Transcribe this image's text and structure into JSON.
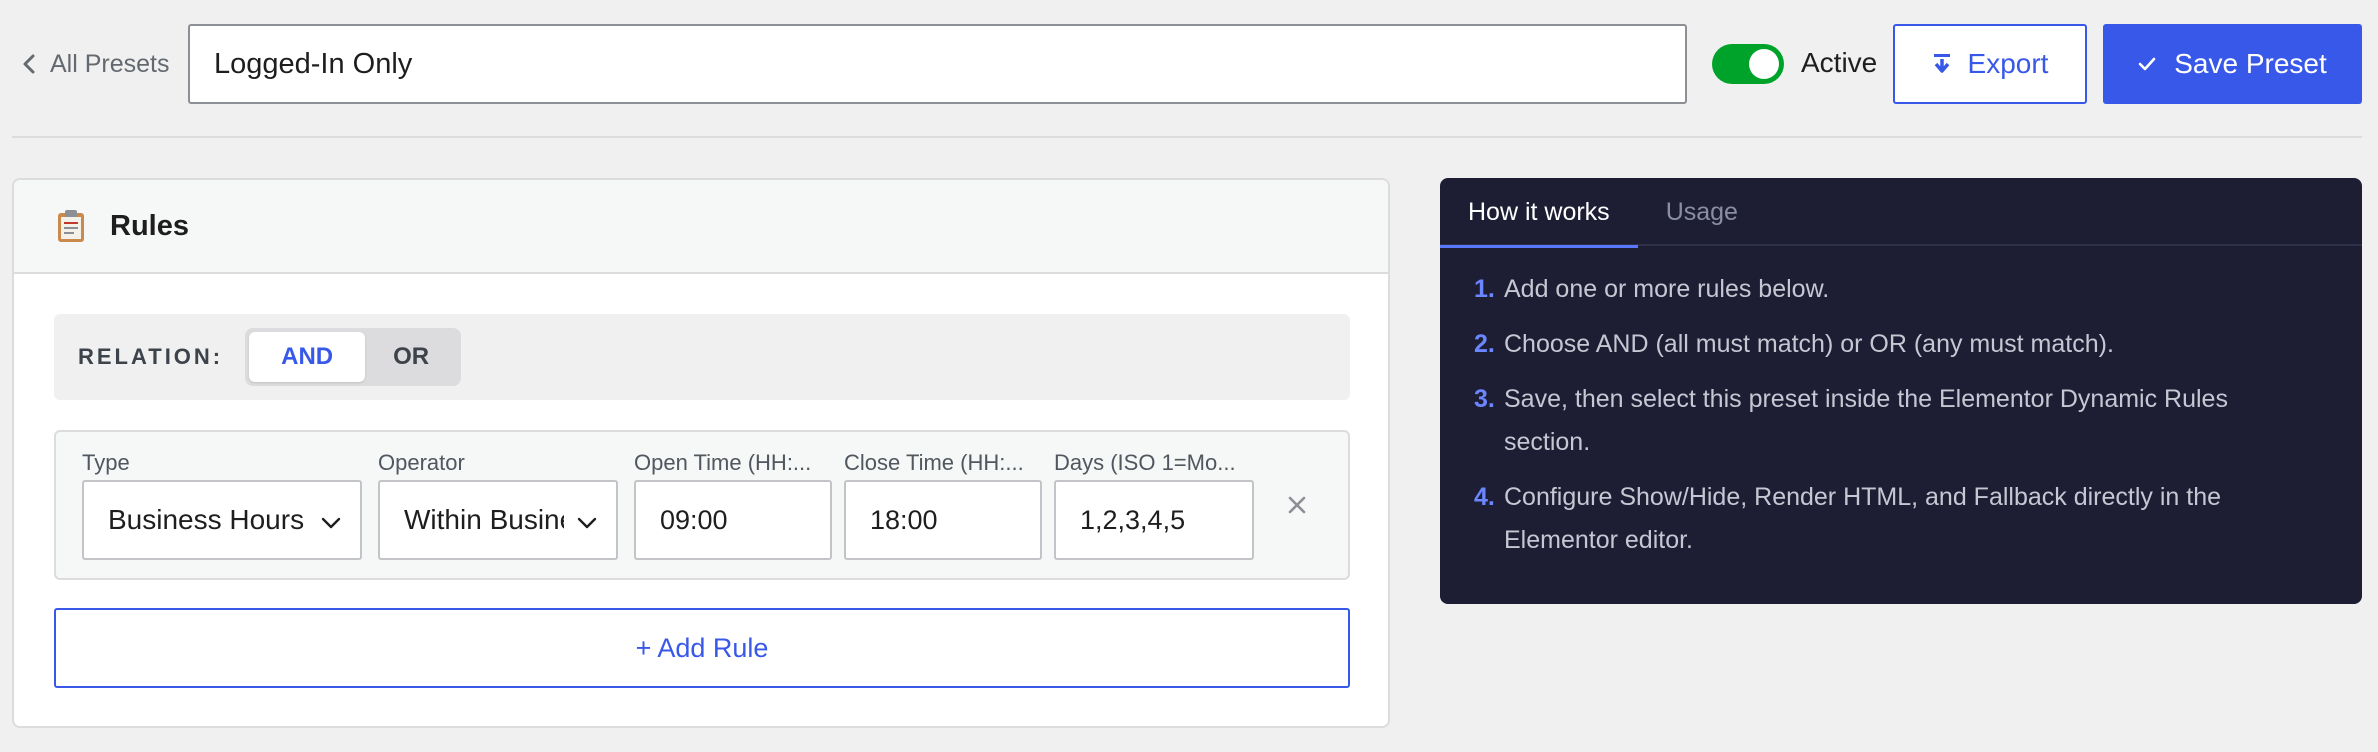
{
  "header": {
    "back_label": "All Presets",
    "preset_name": "Logged-In Only",
    "active_label": "Active",
    "active": true,
    "export_label": "Export",
    "save_label": "Save Preset"
  },
  "rules": {
    "title": "Rules",
    "relation_label": "RELATION:",
    "relation_options": [
      "AND",
      "OR"
    ],
    "relation_selected": "AND",
    "fields": {
      "type": {
        "label": "Type",
        "value": "Business Hours"
      },
      "operator": {
        "label": "Operator",
        "value": "Within Business Hours"
      },
      "open_time": {
        "label": "Open Time (HH:...",
        "value": "09:00"
      },
      "close_time": {
        "label": "Close Time (HH:...",
        "value": "18:00"
      },
      "days": {
        "label": "Days (ISO 1=Mo...",
        "value": "1,2,3,4,5"
      }
    },
    "add_rule_label": "+ Add Rule"
  },
  "help": {
    "tabs": [
      "How it works",
      "Usage"
    ],
    "active_tab": "How it works",
    "steps": [
      {
        "num": "1.",
        "text": "Add one or more rules below."
      },
      {
        "num": "2.",
        "text": "Choose AND (all must match) or OR (any must match)."
      },
      {
        "num": "3.",
        "text": "Save, then select this preset inside the Elementor Dynamic Rules section."
      },
      {
        "num": "4.",
        "text": "Configure Show/Hide, Render HTML, and Fallback directly in the Elementor editor."
      }
    ]
  },
  "colors": {
    "accent": "#3858e9",
    "toggle_on": "#00a32a",
    "help_bg": "#1d1e34",
    "step_number": "#6b86ff"
  },
  "icons": {
    "back": "chevron-left-icon",
    "export": "download-arrow-icon",
    "save": "checkmark-icon",
    "rules": "clipboard-icon",
    "select": "chevron-down-icon",
    "remove": "close-icon"
  }
}
